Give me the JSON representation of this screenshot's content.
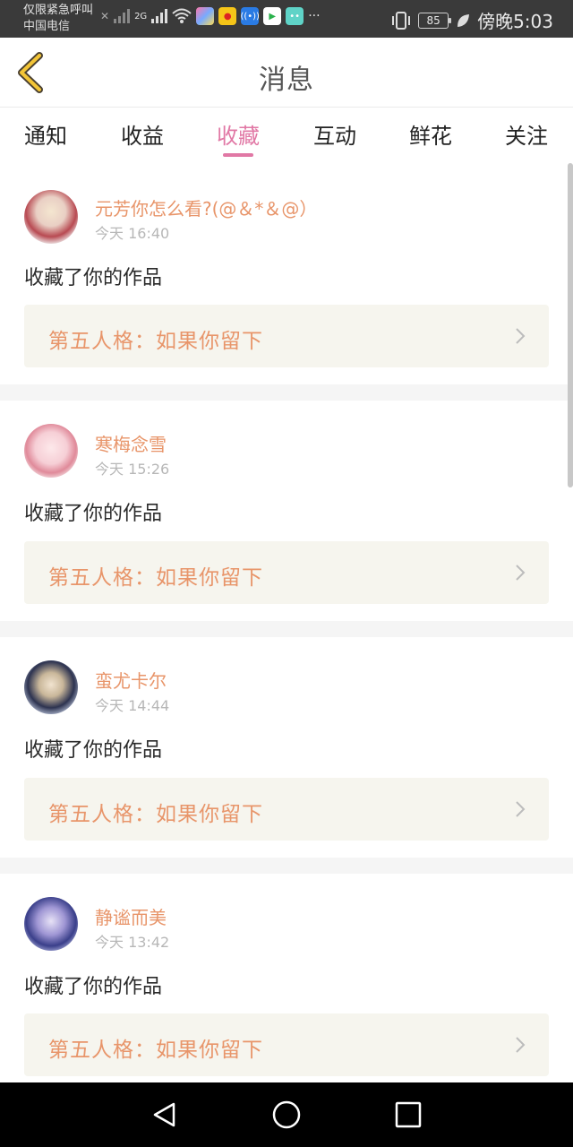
{
  "status_bar": {
    "emergency": "仅限紧急呼叫",
    "carrier": "中国电信",
    "network": "2G",
    "battery": "85",
    "time": "傍晚5:03",
    "more": "···"
  },
  "header": {
    "title": "消息"
  },
  "tabs": [
    {
      "label": "通知"
    },
    {
      "label": "收益"
    },
    {
      "label": "收藏",
      "active": true
    },
    {
      "label": "互动"
    },
    {
      "label": "鲜花"
    },
    {
      "label": "关注"
    }
  ],
  "messages": [
    {
      "user": "元芳你怎么看?(@＆*＆@）",
      "time": "今天 16:40",
      "action": "收藏了你的作品",
      "work": "第五人格：如果你留下"
    },
    {
      "user": "寒梅念雪",
      "time": "今天 15:26",
      "action": "收藏了你的作品",
      "work": "第五人格：如果你留下"
    },
    {
      "user": "蛮尤卡尔",
      "time": "今天 14:44",
      "action": "收藏了你的作品",
      "work": "第五人格：如果你留下"
    },
    {
      "user": "静谧而美",
      "time": "今天 13:42",
      "action": "收藏了你的作品",
      "work": "第五人格：如果你留下"
    }
  ],
  "colors": {
    "accent": "#e178a5",
    "name": "#e8956a",
    "box_bg": "#f6f5ee"
  }
}
